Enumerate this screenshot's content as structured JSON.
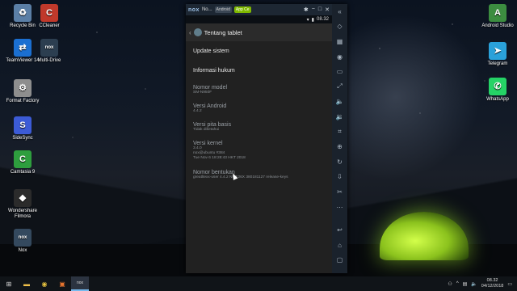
{
  "desktop": {
    "left_icons": [
      {
        "label": "Recycle Bin",
        "icon": "recycle-bin-icon",
        "color": "#5b7fa6",
        "glyph": "♻"
      },
      {
        "label": "CCleaner",
        "icon": "ccleaner-icon",
        "color": "#c0392b",
        "glyph": "C"
      },
      {
        "label": "TeamViewer 14",
        "icon": "teamviewer-icon",
        "color": "#1b6fd1",
        "glyph": "⇄"
      },
      {
        "label": "Multi-Drive",
        "icon": "multi-drive-icon",
        "color": "#2c3e50",
        "glyph": "nox"
      },
      {
        "label": "Format Factory",
        "icon": "format-factory-icon",
        "color": "#8e8e8e",
        "glyph": "⚙"
      },
      {
        "label": "SideSync",
        "icon": "sidesync-icon",
        "color": "#3c5bd6",
        "glyph": "S"
      },
      {
        "label": "Camtasia 9",
        "icon": "camtasia-icon",
        "color": "#2e9e3e",
        "glyph": "C"
      },
      {
        "label": "Wondershare Filmora",
        "icon": "filmora-icon",
        "color": "#2b2b2b",
        "glyph": "◆"
      },
      {
        "label": "Nox",
        "icon": "nox-icon",
        "color": "#34495e",
        "glyph": "nox"
      }
    ],
    "right_icons": [
      {
        "label": "Android Studio",
        "icon": "android-studio-icon",
        "color": "#3c8d40",
        "glyph": "A"
      },
      {
        "label": "Telegram",
        "icon": "telegram-icon",
        "color": "#2aa1da",
        "glyph": "➤"
      },
      {
        "label": "WhatsApp",
        "icon": "whatsapp-icon",
        "color": "#25d366",
        "glyph": "✆"
      }
    ]
  },
  "emulator": {
    "logo": "nox",
    "name": "No...",
    "tag_android": "Android",
    "tag_app": "App Ce",
    "status_time": "08.32",
    "screen_title": "Tentang tablet",
    "side_buttons": [
      "rotate-icon",
      "screenshot-icon",
      "location-icon",
      "display-icon",
      "fullscreen-icon",
      "volume-up-icon",
      "volume-down-icon",
      "apk-install-icon",
      "multi-instance-icon",
      "refresh-icon",
      "sync-icon",
      "scissors-icon",
      "more-icon",
      "back-icon",
      "home-icon",
      "recent-apps-icon"
    ],
    "side_glyphs": [
      "◇",
      "▦",
      "◉",
      "▭",
      "⤢",
      "🔈",
      "🔉",
      "⌗",
      "⊕",
      "↻",
      "⇩",
      "✂",
      "⋯",
      "↩",
      "⌂",
      "▢"
    ],
    "items": [
      {
        "title": "Update sistem"
      },
      {
        "title": "Informasi hukum"
      },
      {
        "title": "Nomor model",
        "sub": [
          "SM-N950F"
        ]
      },
      {
        "title": "Versi Android",
        "sub": [
          "4.4.2"
        ]
      },
      {
        "title": "Versi pita basis",
        "sub": [
          "Tidak diketahui"
        ]
      },
      {
        "title": "Versi kernel",
        "sub": [
          "3.4.0",
          "nox@ubuntu #384",
          "Tue Nov 6 18:28:43 HKT 2018"
        ]
      },
      {
        "title": "Nomor bentukan",
        "sub": [
          "greatltexx-user 4.4.2 NMF26X 380181127 release-keys"
        ]
      }
    ]
  },
  "taskbar": {
    "items": [
      {
        "name": "start-button",
        "glyph": "⊞"
      },
      {
        "name": "file-explorer-icon",
        "glyph": "▬"
      },
      {
        "name": "chrome-icon",
        "glyph": "◉"
      },
      {
        "name": "app-orange-icon",
        "glyph": "▣"
      },
      {
        "name": "nox-taskbar-icon",
        "glyph": "nox"
      }
    ],
    "time": "08.32",
    "date": "04/12/2018"
  }
}
